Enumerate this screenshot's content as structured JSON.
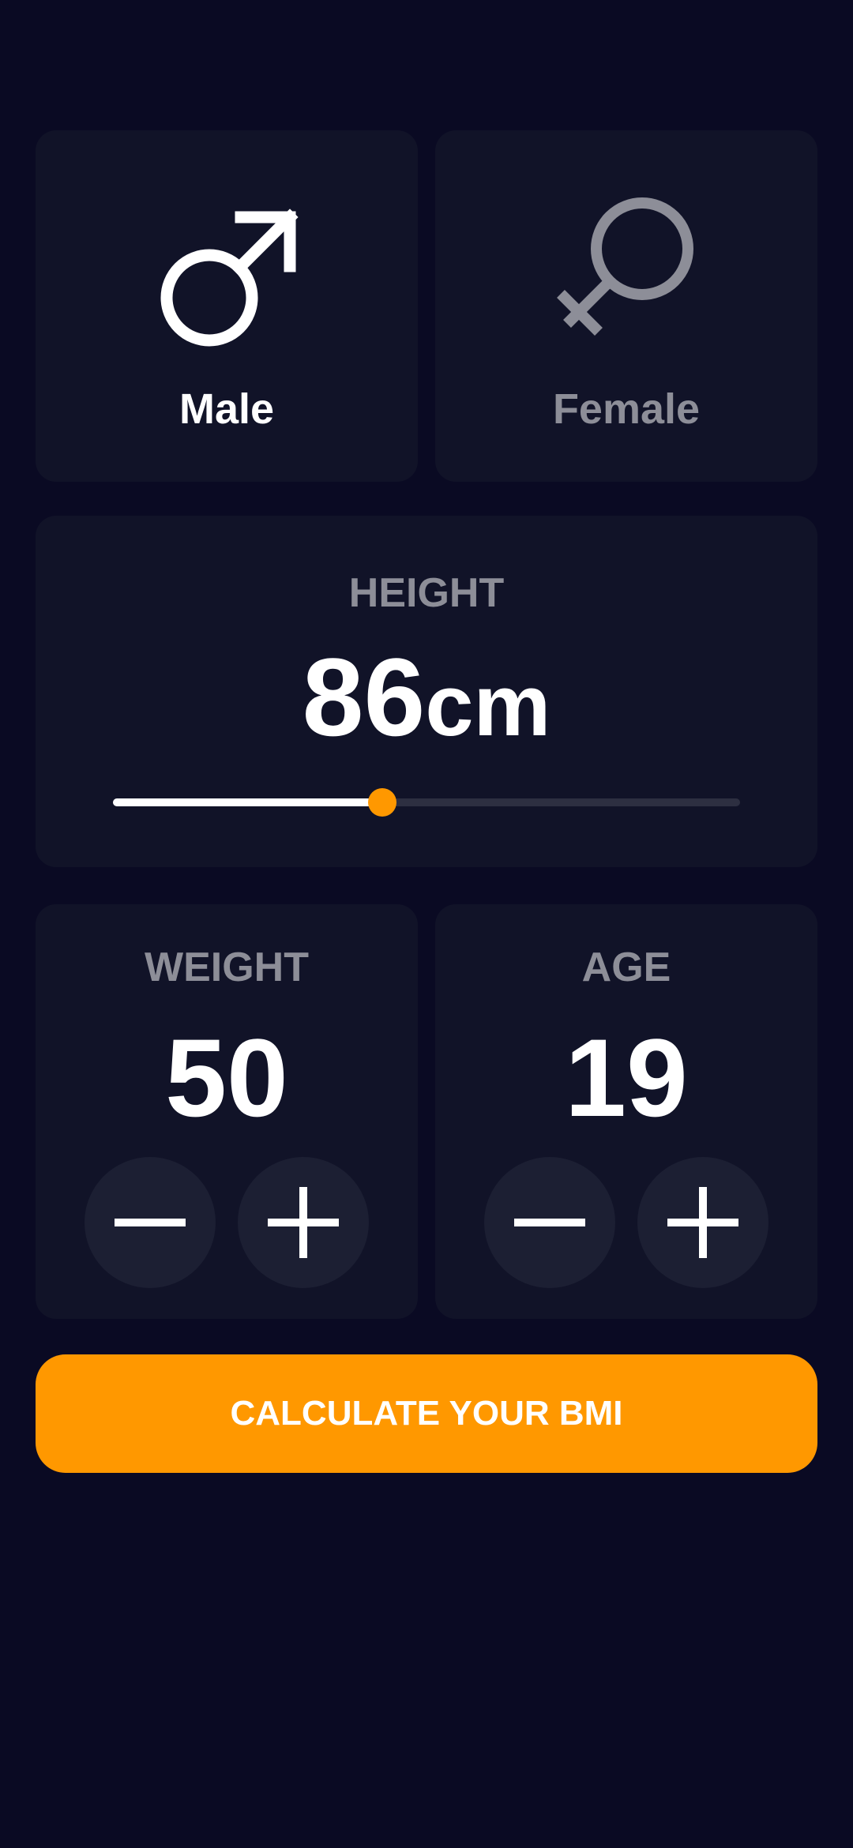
{
  "gender": {
    "male": {
      "label": "Male",
      "icon": "male-symbol-icon",
      "selected": true
    },
    "female": {
      "label": "Female",
      "icon": "female-symbol-icon",
      "selected": false
    }
  },
  "height": {
    "title": "HEIGHT",
    "value": "86",
    "unit": "cm",
    "slider_fraction": 0.43
  },
  "weight": {
    "title": "WEIGHT",
    "value": "50",
    "minus_icon": "minus-icon",
    "plus_icon": "plus-icon"
  },
  "age": {
    "title": "AGE",
    "value": "19",
    "minus_icon": "minus-icon",
    "plus_icon": "plus-icon"
  },
  "calculate": {
    "label": "CALCULATE YOUR BMI"
  },
  "colors": {
    "background": "#0a0a23",
    "card": "#111328",
    "accent": "#ff9800",
    "inactive": "#8d8e98",
    "button_round": "#1c1f33"
  }
}
